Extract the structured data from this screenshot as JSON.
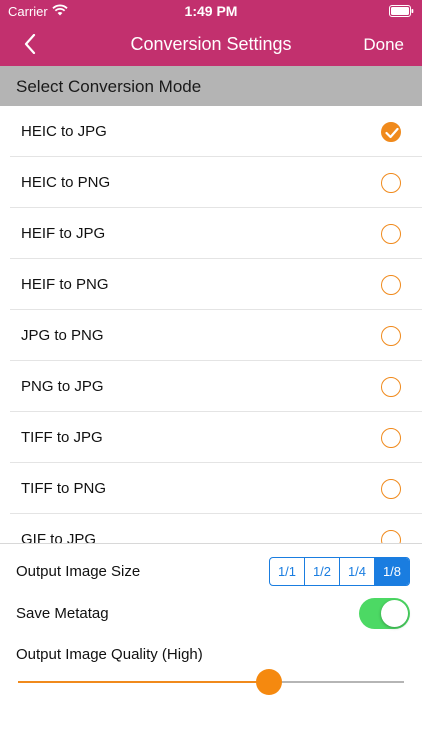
{
  "status_bar": {
    "carrier": "Carrier",
    "time": "1:49 PM"
  },
  "nav": {
    "title": "Conversion Settings",
    "done_label": "Done",
    "background_color": "#c2306e"
  },
  "section": {
    "title": "Select Conversion Mode"
  },
  "modes": [
    {
      "label": "HEIC to JPG",
      "selected": true
    },
    {
      "label": "HEIC to PNG",
      "selected": false
    },
    {
      "label": "HEIF to JPG",
      "selected": false
    },
    {
      "label": "HEIF to PNG",
      "selected": false
    },
    {
      "label": "JPG to PNG",
      "selected": false
    },
    {
      "label": "PNG to JPG",
      "selected": false
    },
    {
      "label": "TIFF to JPG",
      "selected": false
    },
    {
      "label": "TIFF to PNG",
      "selected": false
    },
    {
      "label": "GIF to JPG",
      "selected": false
    }
  ],
  "settings": {
    "size_label": "Output Image Size",
    "size_options": [
      "1/1",
      "1/2",
      "1/4",
      "1/8"
    ],
    "size_selected": "1/8",
    "metatag_label": "Save Metatag",
    "metatag_on": true,
    "quality_label": "Output Image Quality (High)",
    "quality_fraction": 0.65
  },
  "colors": {
    "accent_orange": "#f08a1c",
    "segment_blue": "#1a7de0",
    "toggle_green": "#4cd964"
  }
}
